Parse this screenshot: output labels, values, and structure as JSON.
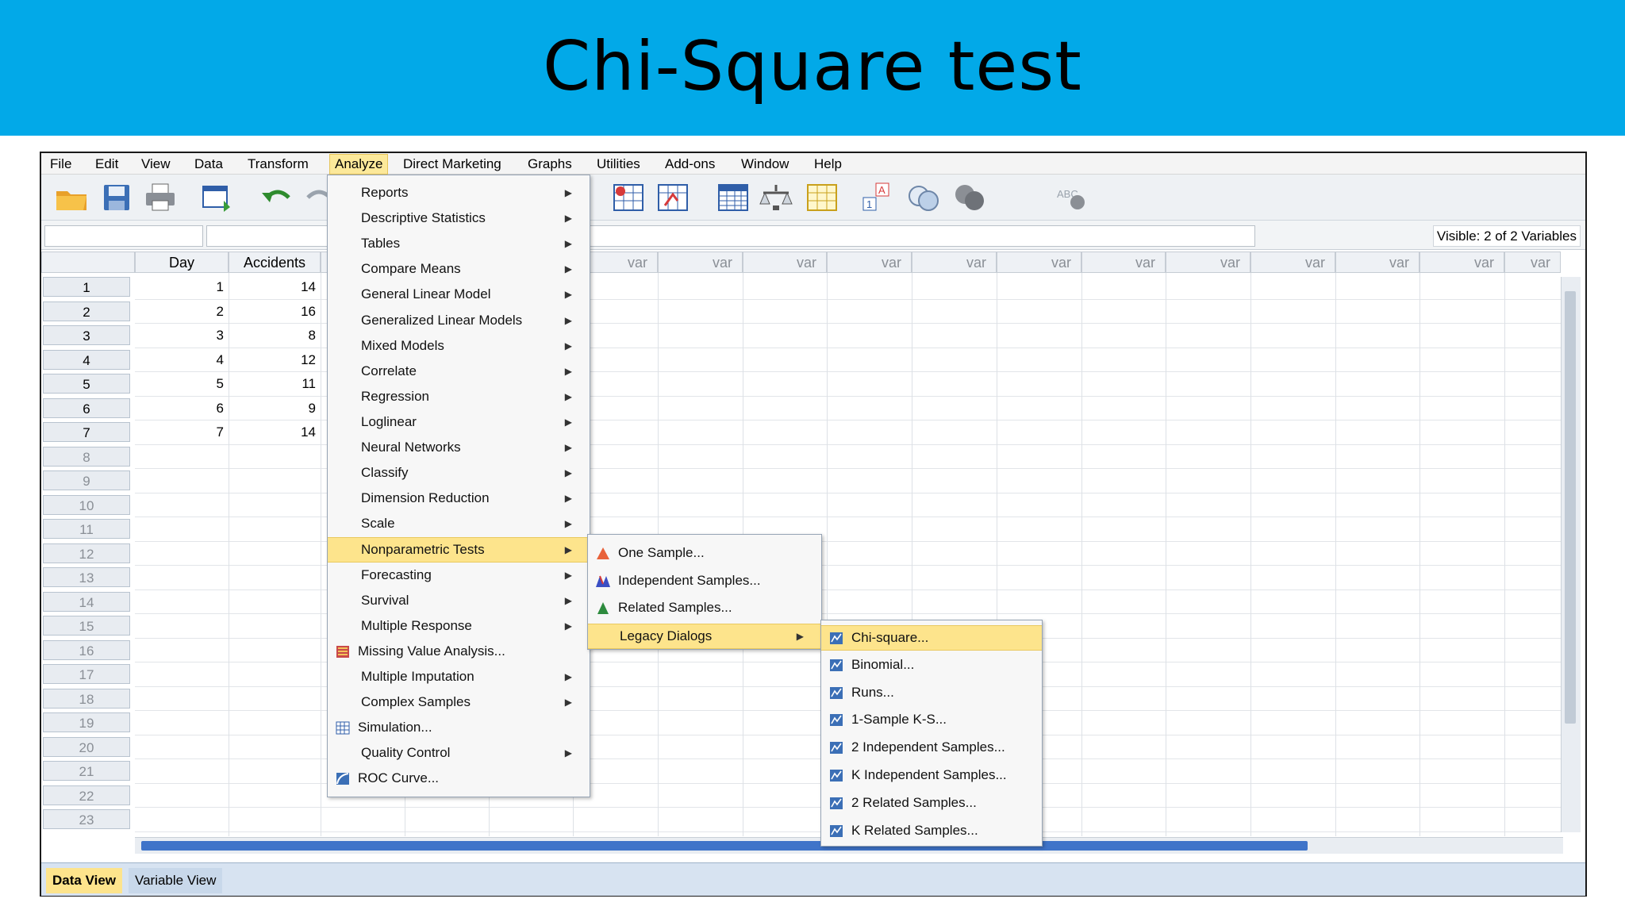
{
  "slide": {
    "title": "Chi-Square test"
  },
  "menubar": [
    "File",
    "Edit",
    "View",
    "Data",
    "Transform",
    "Analyze",
    "Direct Marketing",
    "Graphs",
    "Utilities",
    "Add-ons",
    "Window",
    "Help"
  ],
  "toolbar_icons": [
    "open-folder-icon",
    "save-icon",
    "print-icon",
    "recall-dialog-icon",
    "undo-icon",
    "redo-icon",
    "goto-case-icon",
    "goto-variable-icon",
    "variables-icon",
    "split-file-icon",
    "weight-cases-icon",
    "select-cases-icon",
    "value-labels-icon",
    "use-sets-icon",
    "show-all-variables-icon",
    "spell-check-icon"
  ],
  "status": {
    "visible": "Visible: 2 of 2 Variables"
  },
  "grid": {
    "columns": [
      "Day",
      "Accidents"
    ],
    "var_label": "var",
    "rows": [
      [
        "1",
        "14"
      ],
      [
        "2",
        "16"
      ],
      [
        "3",
        "8"
      ],
      [
        "4",
        "12"
      ],
      [
        "5",
        "11"
      ],
      [
        "6",
        "9"
      ],
      [
        "7",
        "14"
      ]
    ],
    "row_numbers": [
      "1",
      "2",
      "3",
      "4",
      "5",
      "6",
      "7",
      "8",
      "9",
      "10",
      "11",
      "12",
      "13",
      "14",
      "15",
      "16",
      "17",
      "18",
      "19",
      "20",
      "21",
      "22",
      "23"
    ]
  },
  "analyze_menu": [
    "Reports",
    "Descriptive Statistics",
    "Tables",
    "Compare Means",
    "General Linear Model",
    "Generalized Linear Models",
    "Mixed Models",
    "Correlate",
    "Regression",
    "Loglinear",
    "Neural Networks",
    "Classify",
    "Dimension Reduction",
    "Scale",
    "Nonparametric Tests",
    "Forecasting",
    "Survival",
    "Multiple Response",
    "Missing Value Analysis...",
    "Multiple Imputation",
    "Complex Samples",
    "Simulation...",
    "Quality Control",
    "ROC Curve..."
  ],
  "nonparametric_menu": [
    "One Sample...",
    "Independent Samples...",
    "Related Samples...",
    "Legacy Dialogs"
  ],
  "legacy_menu": [
    "Chi-square...",
    "Binomial...",
    "Runs...",
    "1-Sample K-S...",
    "2 Independent Samples...",
    "K Independent Samples...",
    "2 Related Samples...",
    "K Related Samples..."
  ],
  "tabs": {
    "data_view": "Data View",
    "variable_view": "Variable View"
  },
  "colors": {
    "banner": "#02a9e8",
    "highlight": "#fde48c",
    "scroll_thumb": "#3f74c9"
  }
}
